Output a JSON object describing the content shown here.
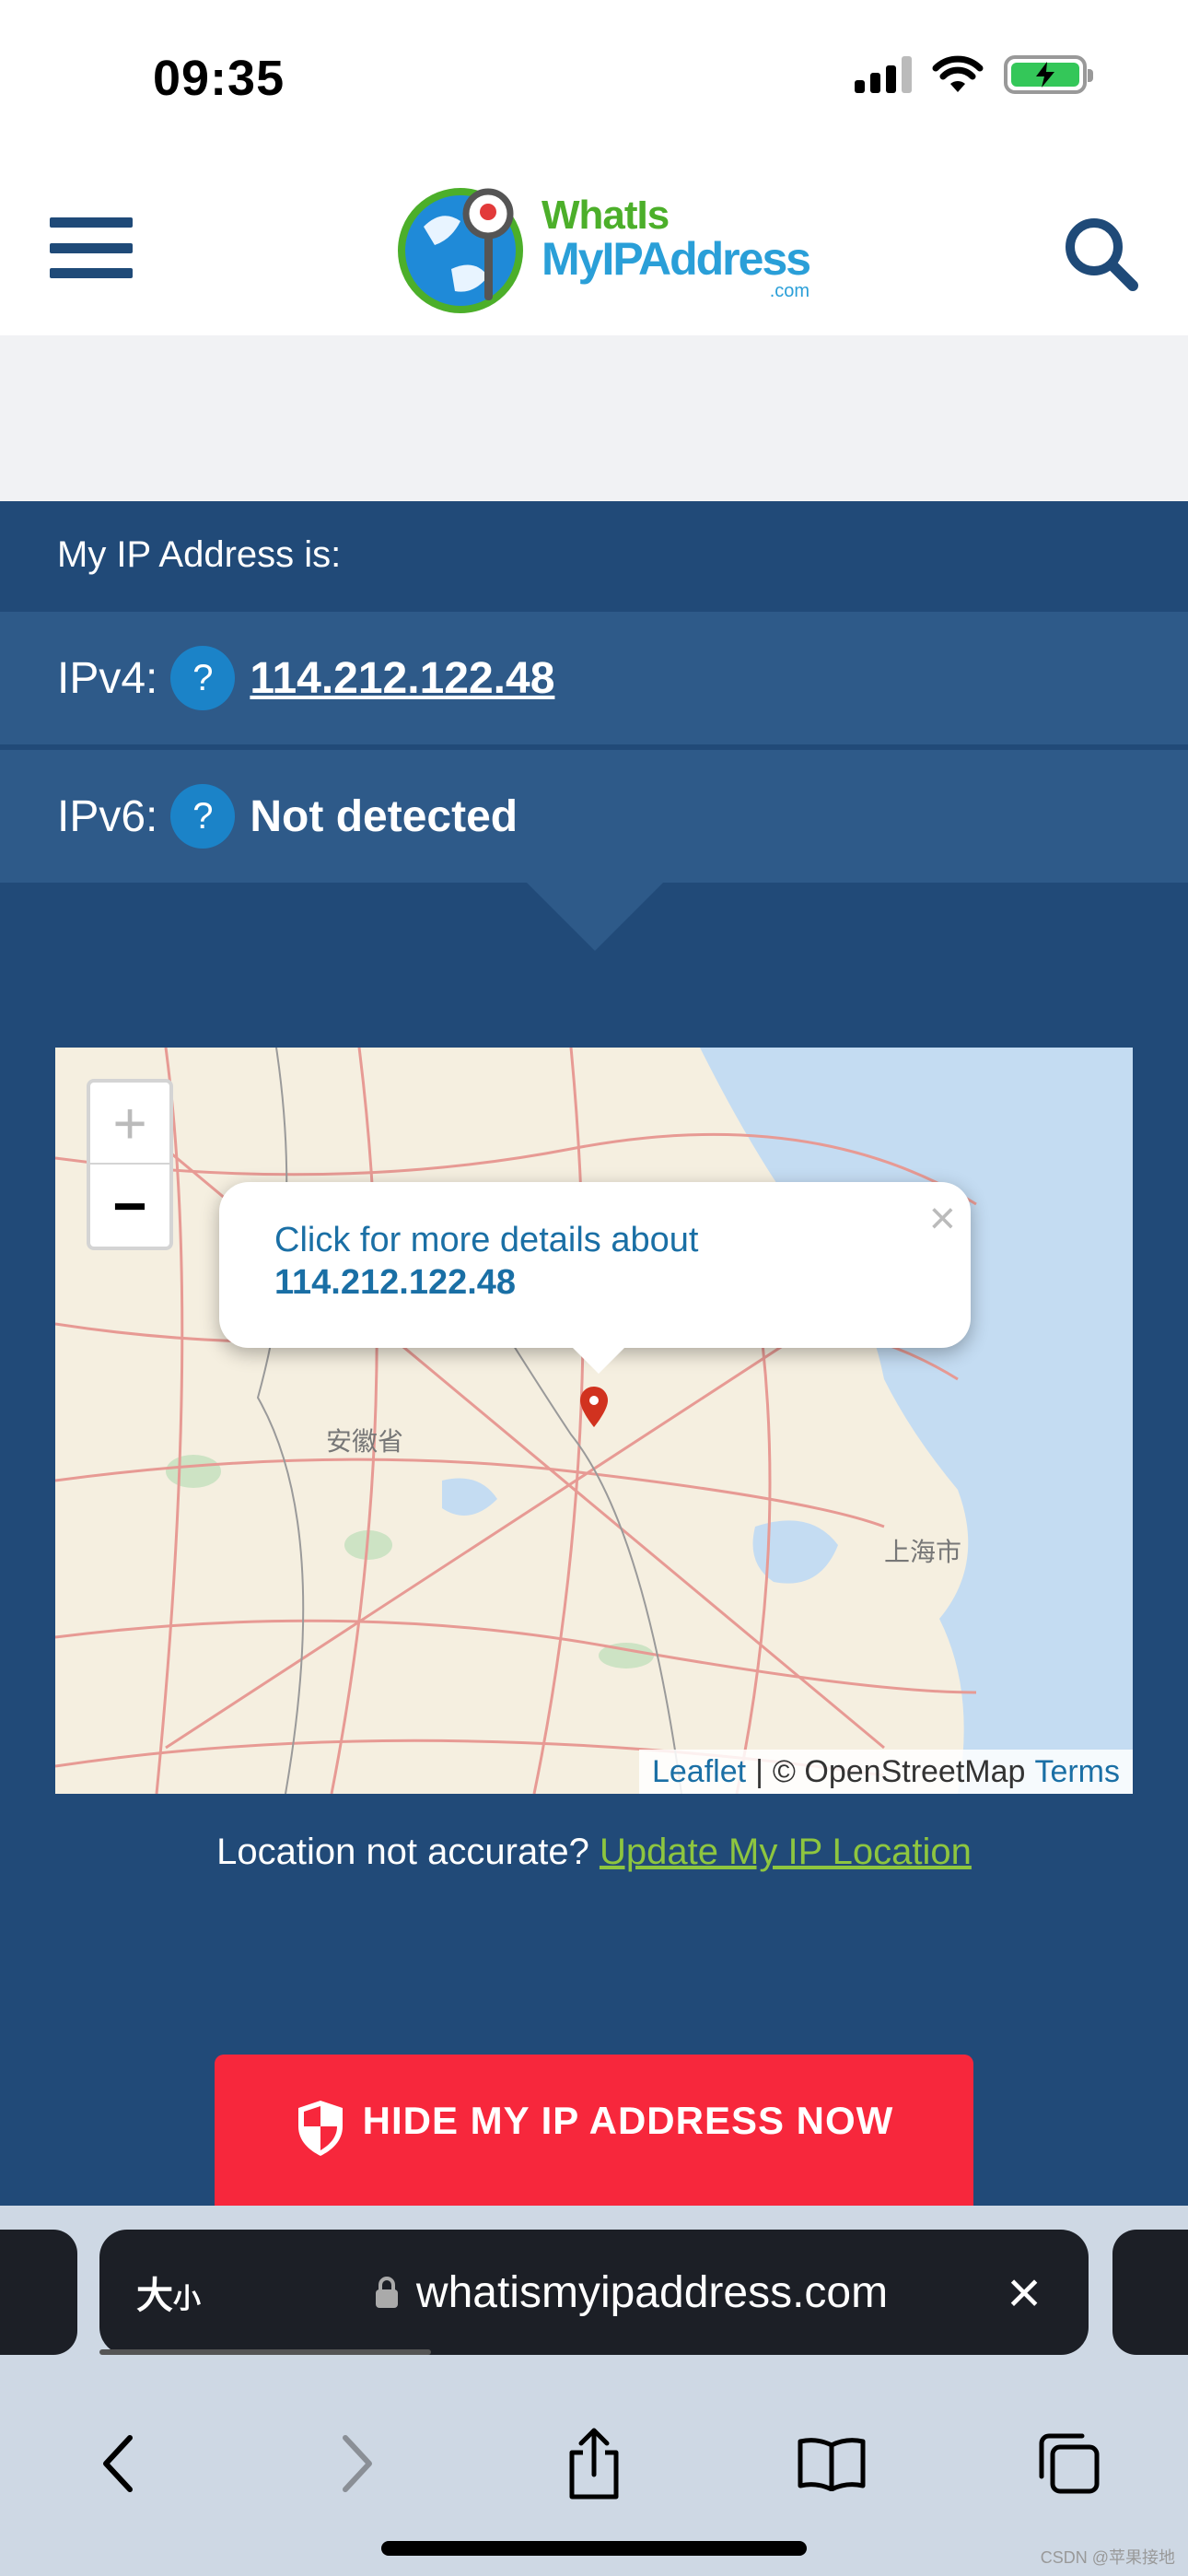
{
  "status_bar": {
    "time": "09:35"
  },
  "header": {
    "logo": {
      "line1": "WhatIs",
      "line2": "MyIPAddress",
      "line3": ".com"
    }
  },
  "ip_panel": {
    "heading": "My IP Address is:",
    "ipv4_label": "IPv4:",
    "ipv4_value": "114.212.122.48",
    "ipv6_label": "IPv6:",
    "ipv6_value": "Not detected",
    "help_glyph": "?"
  },
  "map": {
    "zoom_in": "+",
    "zoom_out": "−",
    "popup_text": "Click for more details about",
    "popup_ip": "114.212.122.48",
    "popup_close": "×",
    "label_anhui": "安徽省",
    "label_shanghai": "上海市",
    "attribution": {
      "leaflet": "Leaflet",
      "separator": "|",
      "osm": "© OpenStreetMap",
      "terms": "Terms"
    }
  },
  "location": {
    "prompt": "Location not accurate?",
    "link": "Update My IP Location"
  },
  "hide_button": {
    "label": "HIDE MY IP ADDRESS NOW"
  },
  "safari": {
    "aa_big": "大",
    "aa_small": "小",
    "url": "whatismyipaddress.com",
    "close": "×"
  },
  "watermark": "CSDN @苹果接地",
  "icons": [
    "hamburger-icon",
    "search-icon",
    "shield-icon",
    "lock-icon",
    "map-marker-icon",
    "back-icon",
    "forward-icon",
    "share-icon",
    "bookmarks-icon",
    "tabs-icon"
  ]
}
